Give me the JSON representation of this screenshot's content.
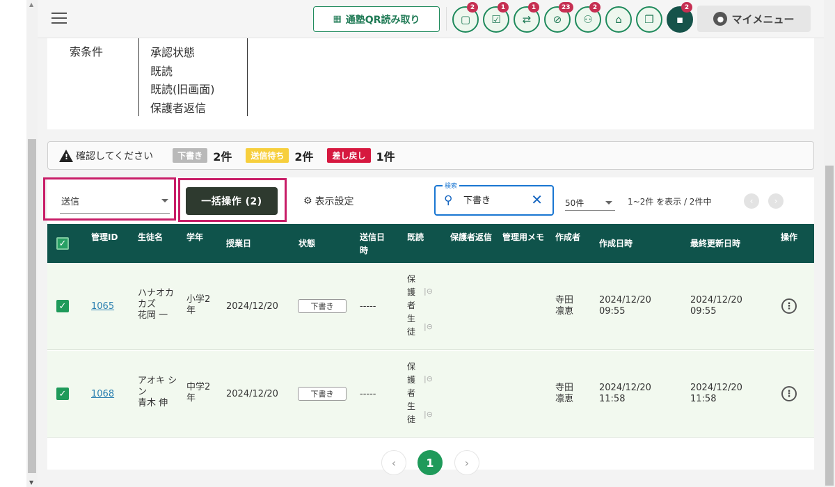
{
  "header": {
    "qr_label": "通塾QR読み取り",
    "icons": [
      {
        "name": "chat-icon",
        "badge": "2"
      },
      {
        "name": "checklist-icon",
        "badge": "1"
      },
      {
        "name": "transfer-icon",
        "badge": "1"
      },
      {
        "name": "blocked-icon",
        "badge": "23"
      },
      {
        "name": "group-icon",
        "badge": "2"
      },
      {
        "name": "school-icon",
        "badge": ""
      },
      {
        "name": "gift-icon",
        "badge": ""
      },
      {
        "name": "message-icon",
        "badge": "2"
      }
    ],
    "mymenu_label": "マイメニュー"
  },
  "conditions": {
    "label": "索条件",
    "items": [
      "承認状態",
      "既読",
      "既読(旧画面)",
      "保護者返信"
    ]
  },
  "alert": {
    "message": "確認してください",
    "draft_label": "下書き",
    "draft_count": "2件",
    "waiting_label": "送信待ち",
    "waiting_count": "2件",
    "returned_label": "差し戻し",
    "returned_count": "1件"
  },
  "toolbar": {
    "send_select": "送信",
    "bulk_label": "一括操作 (2)",
    "display_settings": "表示設定",
    "search_label": "検索",
    "search_value": "下書き",
    "per_page": "50件",
    "range_text": "1~2件 を表示 / 2件中"
  },
  "table": {
    "headers": [
      "管理ID",
      "生徒名",
      "学年",
      "授業日",
      "状態",
      "送信日時",
      "既読",
      "保護者返信",
      "管理用メモ",
      "作成者",
      "作成日時",
      "最終更新日時",
      "操作"
    ],
    "rows": [
      {
        "id": "1065",
        "kana_1": "ハナオカ",
        "kana_2": "カズ",
        "name": "花岡 一",
        "grade_1": "小学2",
        "grade_2": "年",
        "date": "2024/12/20",
        "status": "下書き",
        "sent": "-----",
        "read_1": "保護者",
        "read_2": "生徒",
        "author_1": "寺田",
        "author_2": "凛恵",
        "created_1": "2024/12/20",
        "created_2": "09:55",
        "updated_1": "2024/12/20",
        "updated_2": "09:55"
      },
      {
        "id": "1068",
        "kana_1": "アオキ シ",
        "kana_2": "ン",
        "name": "青木 伸",
        "grade_1": "中学2",
        "grade_2": "年",
        "date": "2024/12/20",
        "status": "下書き",
        "sent": "-----",
        "read_1": "保護者",
        "read_2": "生徒",
        "author_1": "寺田",
        "author_2": "凛恵",
        "created_1": "2024/12/20",
        "created_2": "11:58",
        "updated_1": "2024/12/20",
        "updated_2": "11:58"
      }
    ]
  },
  "pager": {
    "current": "1"
  }
}
